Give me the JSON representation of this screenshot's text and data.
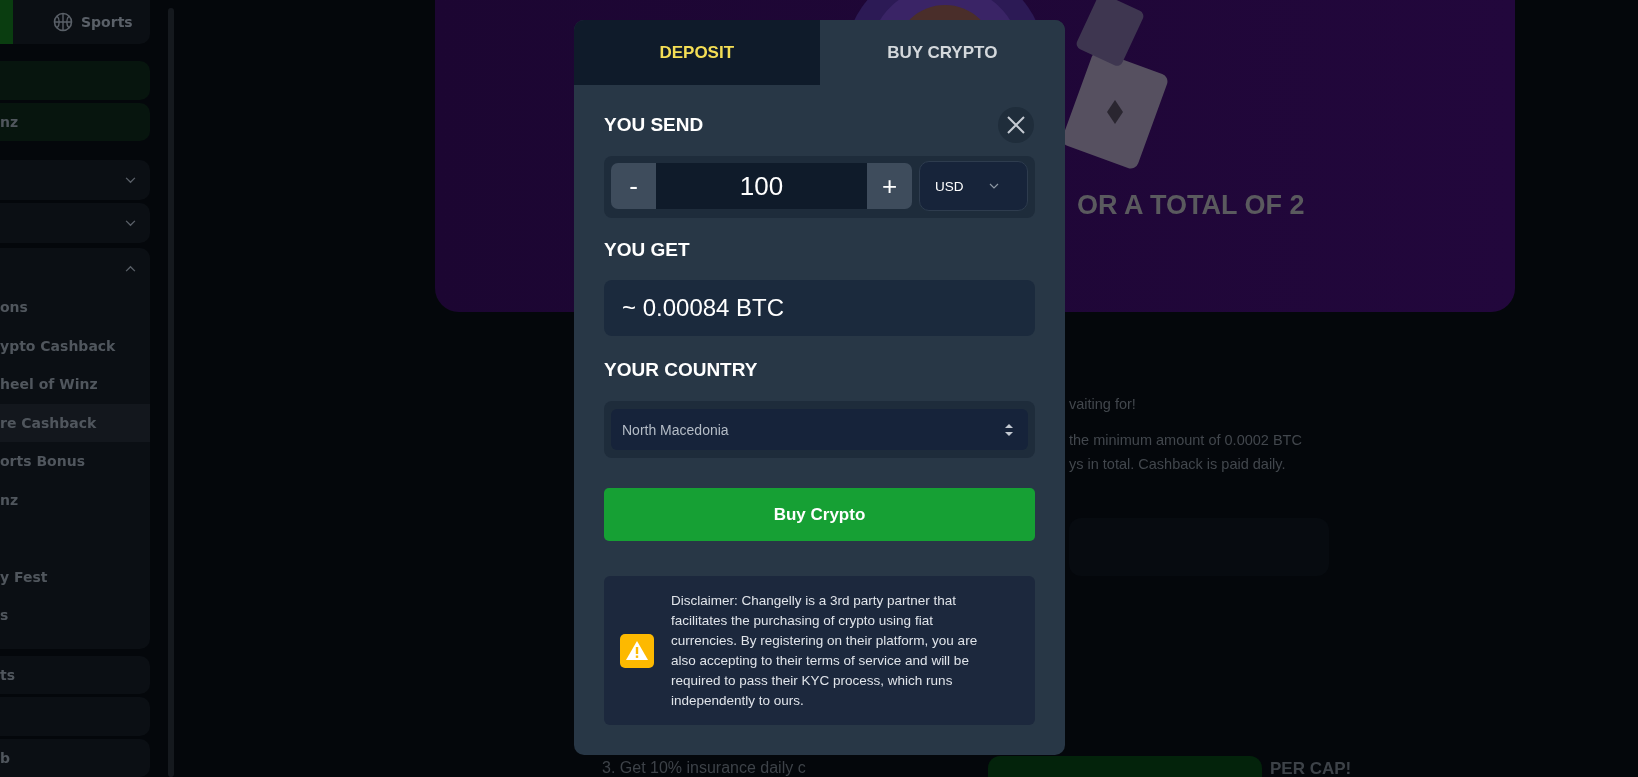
{
  "sidebar": {
    "top_tabs": [
      {
        "selected": true
      },
      {
        "label": "Sports",
        "selected": false
      }
    ],
    "items": [
      {
        "kind": "highlight"
      },
      {
        "label": "nz",
        "kind": "highlight"
      },
      {
        "kind": "group",
        "expanded": false
      },
      {
        "kind": "group",
        "expanded": false
      },
      {
        "kind": "group",
        "expanded": true,
        "children": [
          {
            "label": "ons",
            "selected": false
          },
          {
            "label": "ypto Cashback",
            "selected": false
          },
          {
            "label": "heel of Winz",
            "selected": false
          },
          {
            "label": "re Cashback",
            "selected": true
          },
          {
            "label": "orts Bonus",
            "selected": false
          },
          {
            "label": "nz",
            "selected": false
          },
          {
            "selected": false
          },
          {
            "label": "y Fest",
            "selected": false
          },
          {
            "label": "s",
            "selected": false
          }
        ]
      },
      {
        "label": "ts",
        "kind": "plain"
      },
      {
        "kind": "plain"
      },
      {
        "label": "b",
        "kind": "plain"
      }
    ]
  },
  "banner": {
    "headline": "OR A TOTAL OF 2"
  },
  "content": {
    "paragraphs": [
      "vaiting for!",
      "the minimum amount of 0.0002 BTC\nys in total. Cashback is paid daily."
    ],
    "list_item": "3. Get 10% insurance daily c",
    "list_item_end": "PER CAP!"
  },
  "modal": {
    "tabs": [
      {
        "label": "DEPOSIT",
        "selected": false
      },
      {
        "label": "BUY CRYPTO",
        "selected": true
      }
    ],
    "send_label": "YOU SEND",
    "minus": "-",
    "amount": "100",
    "plus": "+",
    "currency": "USD",
    "get_label": "YOU GET",
    "get_value": "~ 0.00084 BTC",
    "country_label": "YOUR COUNTRY",
    "country": "North Macedonia",
    "button": "Buy Crypto",
    "disclaimer": "Disclaimer: Changelly is a 3rd party partner that facilitates the purchasing of crypto using fiat currencies. By registering on their platform, you are also accepting to their terms of service and will be required to pass their KYC process, which runs independently to ours."
  }
}
